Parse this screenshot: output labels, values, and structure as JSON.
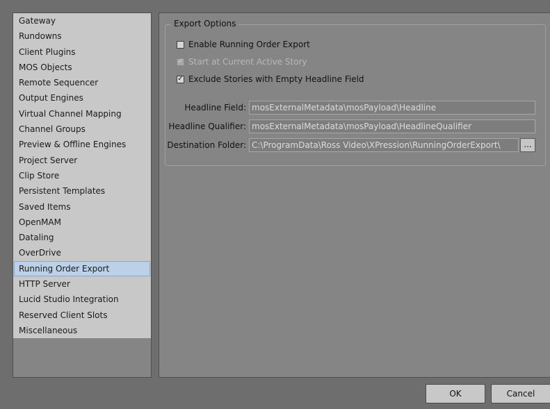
{
  "sidebar": {
    "items": [
      {
        "label": "Gateway"
      },
      {
        "label": "Rundowns"
      },
      {
        "label": "Client Plugins"
      },
      {
        "label": "MOS Objects"
      },
      {
        "label": "Remote Sequencer"
      },
      {
        "label": "Output Engines"
      },
      {
        "label": "Virtual Channel Mapping"
      },
      {
        "label": "Channel Groups"
      },
      {
        "label": "Preview & Offline Engines"
      },
      {
        "label": "Project Server"
      },
      {
        "label": "Clip Store"
      },
      {
        "label": "Persistent Templates"
      },
      {
        "label": "Saved Items"
      },
      {
        "label": "OpenMAM"
      },
      {
        "label": "Dataling"
      },
      {
        "label": "OverDrive"
      },
      {
        "label": "Running Order Export",
        "selected": true
      },
      {
        "label": "HTTP Server"
      },
      {
        "label": "Lucid Studio Integration"
      },
      {
        "label": "Reserved Client Slots"
      },
      {
        "label": "Miscellaneous"
      }
    ]
  },
  "export_options": {
    "title": "Export Options",
    "enable_export": {
      "label": "Enable Running Order Export",
      "checked": false,
      "mark": ""
    },
    "start_at_current": {
      "label": "Start at Current Active Story",
      "checked": true,
      "disabled": true,
      "mark": "✓"
    },
    "exclude_empty": {
      "label": "Exclude Stories with Empty Headline Field",
      "checked": true,
      "mark": "✓"
    },
    "headline_field": {
      "label": "Headline Field:",
      "value": "mosExternalMetadata\\mosPayload\\Headline"
    },
    "headline_qualifier": {
      "label": "Headline Qualifier:",
      "value": "mosExternalMetadata\\mosPayload\\HeadlineQualifier"
    },
    "destination_folder": {
      "label": "Destination Folder:",
      "value": "C:\\ProgramData\\Ross Video\\XPression\\RunningOrderExport\\",
      "browse_label": "..."
    }
  },
  "footer": {
    "ok_label": "OK",
    "cancel_label": "Cancel"
  }
}
